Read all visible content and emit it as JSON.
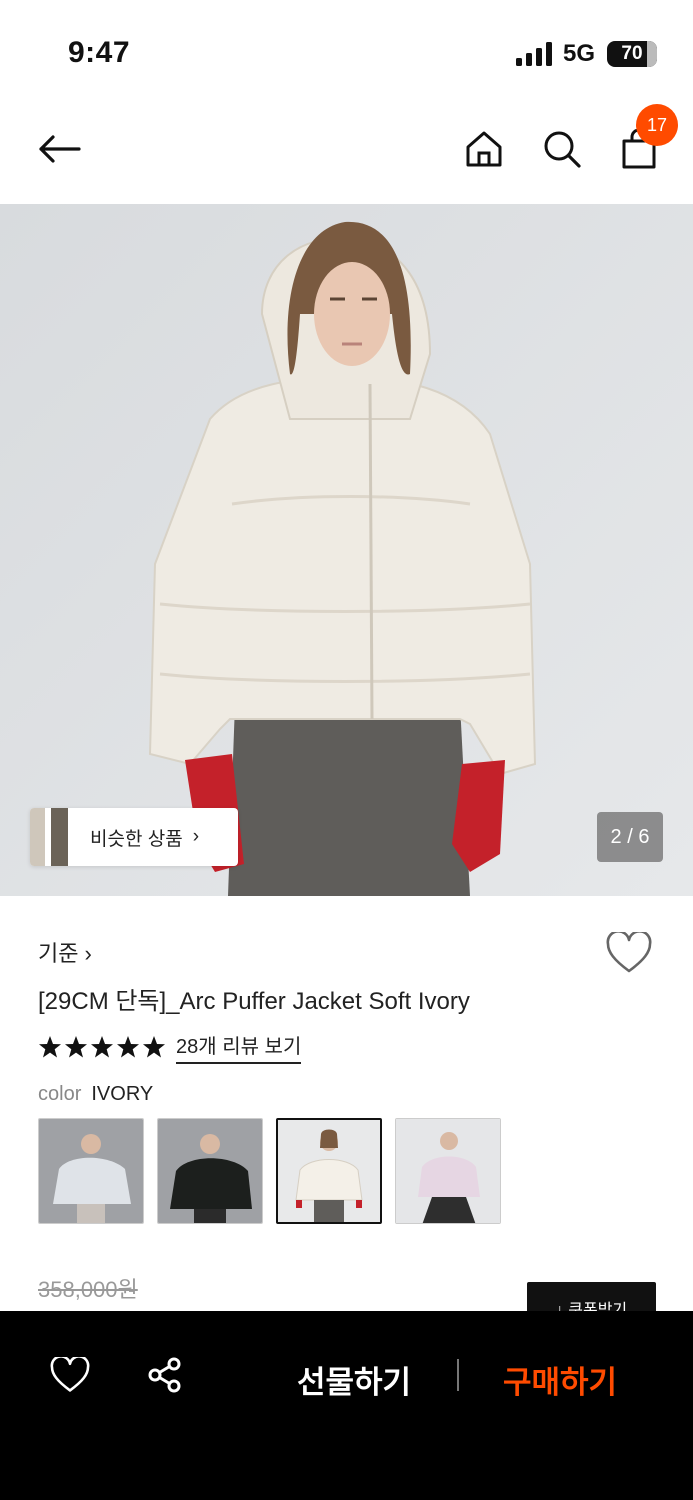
{
  "status": {
    "time": "9:47",
    "network": "5G",
    "battery": "70"
  },
  "nav": {
    "back_icon": "arrow-left-icon",
    "home_icon": "home-icon",
    "search_icon": "search-icon",
    "cart_icon": "shopping-bag-icon",
    "cart_count": "17"
  },
  "hero": {
    "similar_label": "비슷한 상품",
    "similar_chevron": "›",
    "pager": "2 / 6"
  },
  "product": {
    "brand": "기준",
    "brand_chevron": "›",
    "title": "[29CM 단독]_Arc Puffer Jacket Soft Ivory",
    "rating": 5,
    "review_link": "28개 리뷰 보기",
    "color_label": "color",
    "color_value": "IVORY",
    "swatches": [
      "light-gray",
      "black",
      "ivory",
      "pink"
    ],
    "selected_swatch": 2,
    "original_price": "358,000원",
    "coupon_label": "↓ 쿠폰받기"
  },
  "bottom": {
    "gift_label": "선물하기",
    "buy_label": "구매하기"
  },
  "colors": {
    "accent": "#ff4b00",
    "bottom_bar": "#000000"
  }
}
